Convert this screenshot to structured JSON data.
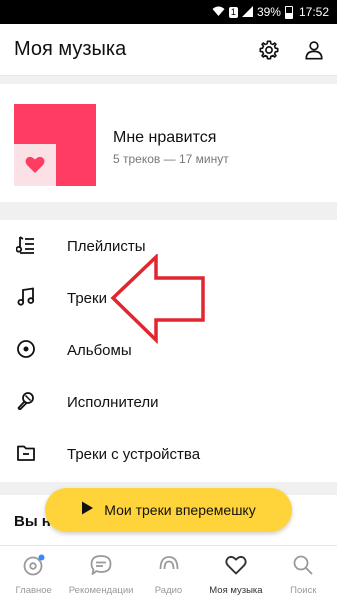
{
  "status_bar": {
    "badge": "1",
    "battery": "39%",
    "time": "17:52"
  },
  "header": {
    "title": "Моя музыка",
    "icons": [
      "gear-icon",
      "profile-icon"
    ]
  },
  "favorite": {
    "title": "Мне нравится",
    "subtitle": "5 треков — 17 минут",
    "cover_color": "#ff3d63"
  },
  "menu": {
    "items": [
      {
        "label": "Плейлисты",
        "icon": "playlist-icon"
      },
      {
        "label": "Треки",
        "icon": "note-icon"
      },
      {
        "label": "Альбомы",
        "icon": "disc-icon"
      },
      {
        "label": "Исполнители",
        "icon": "artist-icon"
      },
      {
        "label": "Треки с устройства",
        "icon": "folder-icon"
      }
    ]
  },
  "section_peek": {
    "title": "Вы н"
  },
  "shuffle_button": {
    "label": "Мои треки вперемешку",
    "color": "#ffd43b"
  },
  "tabbar": {
    "tabs": [
      {
        "label": "Главное",
        "icon": "home-icon"
      },
      {
        "label": "Рекомендации",
        "icon": "chat-icon"
      },
      {
        "label": "Радио",
        "icon": "radio-icon"
      },
      {
        "label": "Моя музыка",
        "icon": "heart-icon",
        "active": true
      },
      {
        "label": "Поиск",
        "icon": "search-icon"
      }
    ]
  },
  "annotation_color": "#e0262f"
}
